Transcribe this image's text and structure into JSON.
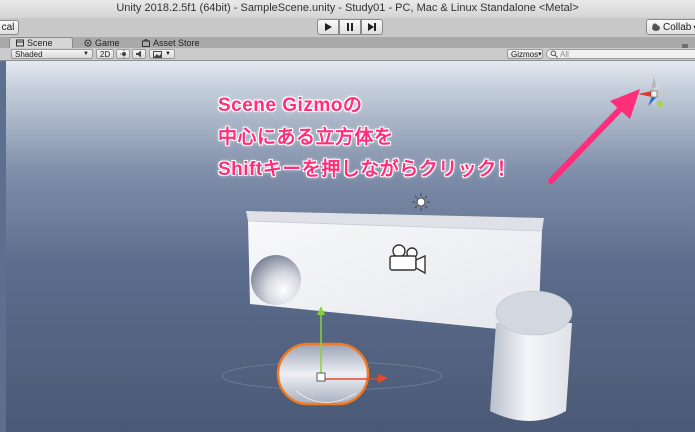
{
  "window": {
    "title": "Unity 2018.2.5f1 (64bit) - SampleScene.unity - Study01 - PC, Mac & Linux Standalone <Metal>"
  },
  "toolbar": {
    "left_label": "cal",
    "play_icon": "play-icon",
    "pause_icon": "pause-icon",
    "step_icon": "step-icon",
    "collab_label": "Collab",
    "collab_arrow": "▾"
  },
  "tabs": [
    {
      "label": "Scene",
      "icon": "scene-icon",
      "active": true
    },
    {
      "label": "Game",
      "icon": "game-icon",
      "active": false
    },
    {
      "label": "Asset Store",
      "icon": "asset-store-icon",
      "active": false
    }
  ],
  "scene_toolbar": {
    "shading_mode": "Shaded",
    "mode_2d": "2D",
    "gizmos_label": "Gizmos",
    "gizmos_arrow": "▾",
    "search_placeholder": "All"
  },
  "annotation": {
    "lines": [
      "Scene Gizmoの",
      "中心にある立方体を",
      "Shiftキーを押しながらクリック！"
    ],
    "color": "#ff2d7a"
  }
}
